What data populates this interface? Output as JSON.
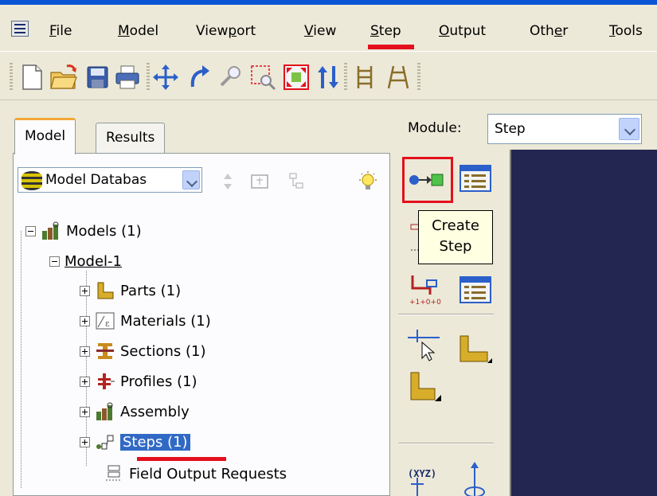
{
  "menu": {
    "items": [
      {
        "pre": "",
        "u": "F",
        "post": "ile"
      },
      {
        "pre": "",
        "u": "M",
        "post": "odel"
      },
      {
        "pre": "View",
        "u": "p",
        "post": "ort"
      },
      {
        "pre": "",
        "u": "V",
        "post": "iew"
      },
      {
        "pre": "",
        "u": "S",
        "post": "tep"
      },
      {
        "pre": "",
        "u": "O",
        "post": "utput"
      },
      {
        "pre": "Oth",
        "u": "e",
        "post": "r"
      },
      {
        "pre": "",
        "u": "T",
        "post": "ools"
      }
    ]
  },
  "tabs": {
    "model": "Model",
    "results": "Results"
  },
  "database": {
    "label": "Model Databas"
  },
  "module": {
    "label": "Module:",
    "value": "Step"
  },
  "tree": {
    "models": "Models (1)",
    "model1": "Model-1",
    "parts": "Parts (1)",
    "materials": "Materials (1)",
    "sections": "Sections (1)",
    "profiles": "Profiles (1)",
    "assembly": "Assembly",
    "steps": "Steps (1)",
    "field_output": "Field Output Requests"
  },
  "tooltip": {
    "line1": "Create",
    "line2": "Step"
  },
  "toolbox": {
    "xyz_label": "(XYZ)"
  },
  "colors": {
    "accent_red": "#e4101c",
    "selection": "#316ac5",
    "viewport": "#222650"
  }
}
